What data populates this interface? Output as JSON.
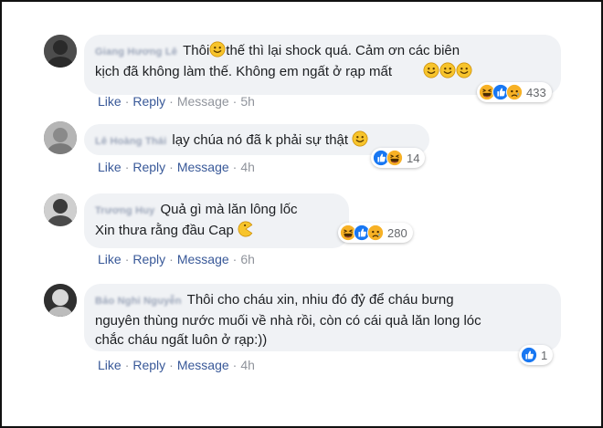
{
  "comments": [
    {
      "author": "Giang Hương Lê",
      "lines": [
        "Thôi",
        "thế thì lại shock quá. Cảm ơn các biên",
        "kịch đã không làm thế. Không em ngất ở rạp mất"
      ],
      "reaction_count": "433",
      "reactions": [
        "haha",
        "like",
        "sad"
      ],
      "actions": {
        "like": "Like",
        "reply": "Reply",
        "message": "Message",
        "time": "5h"
      }
    },
    {
      "author": "Lê Hoàng Thái",
      "lines": [
        "lạy chúa nó đã k phải sự thật"
      ],
      "reaction_count": "14",
      "reactions": [
        "like",
        "haha"
      ],
      "actions": {
        "like": "Like",
        "reply": "Reply",
        "message": "Message",
        "time": "4h"
      }
    },
    {
      "author": "Trương Huy",
      "lines": [
        "Quả gì mà lăn lông lốc",
        "Xin thưa rằng đầu Cap"
      ],
      "reaction_count": "280",
      "reactions": [
        "haha",
        "like",
        "sad"
      ],
      "actions": {
        "like": "Like",
        "reply": "Reply",
        "message": "Message",
        "time": "6h"
      }
    },
    {
      "author": "Bảo Nghi Nguyễn",
      "lines": [
        "Thôi cho cháu xin, nhiu đó đỷ để cháu bưng",
        "nguyên thùng nước muối về nhà rồi, còn có cái quả lăn long lóc",
        "chắc cháu ngất luôn ở rạp:))"
      ],
      "reaction_count": "1",
      "reactions": [
        "like"
      ],
      "actions": {
        "like": "Like",
        "reply": "Reply",
        "message": "Message",
        "time": "4h"
      }
    }
  ],
  "colors": {
    "link": "#385898",
    "bubble": "#f0f2f5",
    "like_blue": "#1877f2",
    "reaction_yellow": "#f7b125"
  },
  "icons": [
    "slightly-smiling-emoji",
    "pacman-emoji",
    "like-reaction-icon",
    "haha-reaction-icon",
    "sad-reaction-icon",
    "avatar"
  ]
}
